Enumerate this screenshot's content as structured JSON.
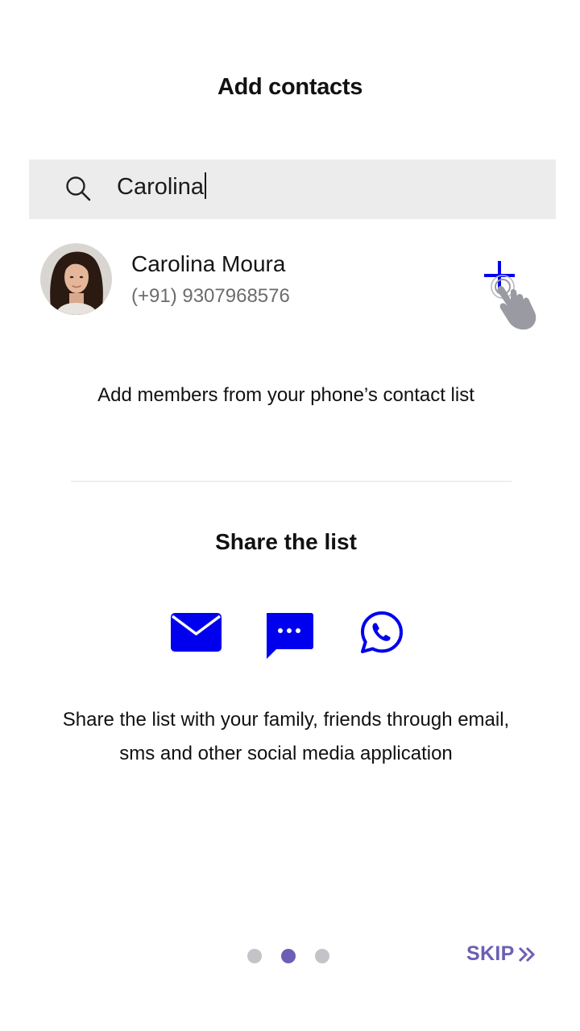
{
  "header": {
    "title": "Add contacts"
  },
  "search": {
    "value": "Carolina",
    "icon": "search-icon"
  },
  "contact": {
    "name": "Carolina Moura",
    "phone": "(+91) 9307968576",
    "add_icon": "plus-icon"
  },
  "hint_text": "Add members from your phone’s contact list",
  "share": {
    "title": "Share the list",
    "options": [
      {
        "icon": "email-icon"
      },
      {
        "icon": "sms-icon"
      },
      {
        "icon": "whatsapp-icon"
      }
    ],
    "description_line1": "Share the list with your family, friends through email,",
    "description_line2": "sms and other social media application"
  },
  "pagination": {
    "total": 3,
    "current": 2
  },
  "skip_label": "SKIP",
  "colors": {
    "accent_blue": "#0000ee",
    "accent_purple": "#6b5fb5",
    "dot_inactive": "#c4c4c8",
    "search_bg": "#ececec",
    "hand_gray": "#9a9aa2"
  }
}
